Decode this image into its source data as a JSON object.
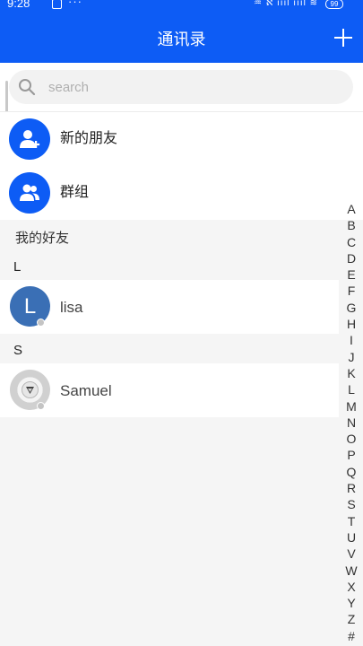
{
  "status_bar": {
    "time": "9:28",
    "dots": "···",
    "right_text": "♒ ℵ ıııl ıııl ≋",
    "battery": "99"
  },
  "header": {
    "title": "通讯录"
  },
  "search": {
    "placeholder": "search"
  },
  "menu": {
    "new_friends": "新的朋友",
    "groups": "群组"
  },
  "section_title": "我的好友",
  "groups": [
    {
      "letter": "L",
      "contacts": [
        {
          "name": "lisa",
          "avatar_letter": "L"
        }
      ]
    },
    {
      "letter": "S",
      "contacts": [
        {
          "name": "Samuel"
        }
      ]
    }
  ],
  "index_letters": [
    "A",
    "B",
    "C",
    "D",
    "E",
    "F",
    "G",
    "H",
    "I",
    "J",
    "K",
    "L",
    "M",
    "N",
    "O",
    "P",
    "Q",
    "R",
    "S",
    "T",
    "U",
    "V",
    "W",
    "X",
    "Y",
    "Z",
    "#"
  ],
  "colors": {
    "accent": "#0d5cf5",
    "avatar_l": "#3a6fb5"
  }
}
